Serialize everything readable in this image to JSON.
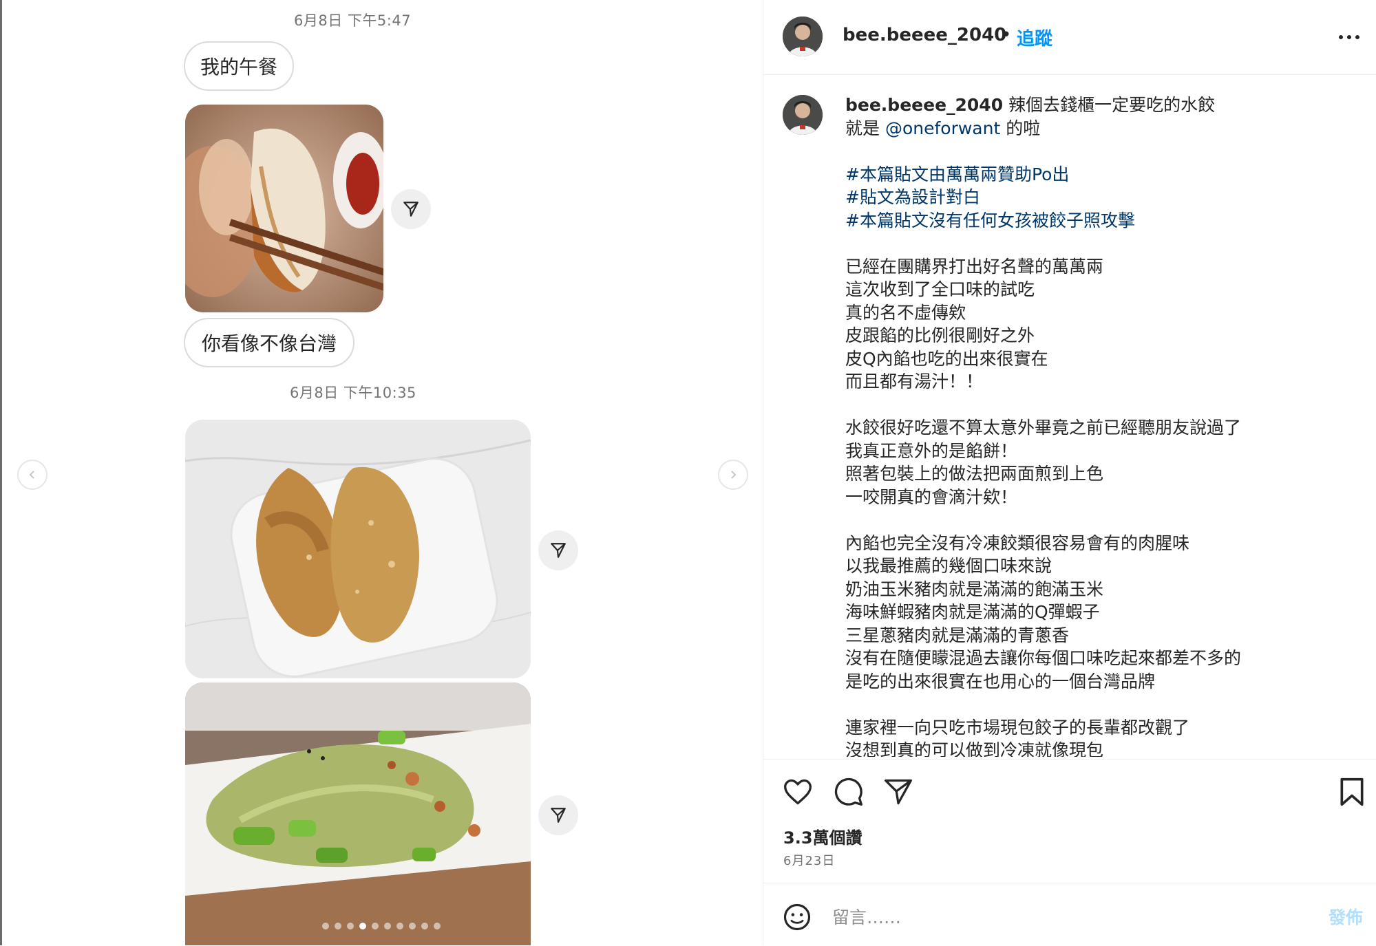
{
  "chat": {
    "timestamp_1": "6月8日 下午5:47",
    "bubble_1": "我的午餐",
    "bubble_2": "你看像不像台灣",
    "timestamp_2": "6月8日 下午10:35"
  },
  "carousel": {
    "slide_count": 10,
    "active_slide": 4
  },
  "post": {
    "username": "bee.beeee_2040",
    "follow_label": "追蹤",
    "caption_first": "辣個去錢櫃一定要吃的水餃",
    "caption_second_prefix": "就是 ",
    "mention": "@oneforwant",
    "caption_second_suffix": " 的啦",
    "hashtags": [
      "#本篇貼文由萬萬兩贊助Po出",
      "#貼文為設計對白",
      "#本篇貼文沒有任何女孩被餃子照攻擊"
    ],
    "paragraph_1": [
      "已經在團購界打出好名聲的萬萬兩",
      "這次收到了全口味的試吃",
      "真的名不虛傳欸",
      "皮跟餡的比例很剛好之外",
      "皮Q內餡也吃的出來很實在",
      "而且都有湯汁！！"
    ],
    "paragraph_2": [
      "水餃很好吃還不算太意外畢竟之前已經聽朋友說過了",
      "我真正意外的是餡餅！",
      "照著包裝上的做法把兩面煎到上色",
      "一咬開真的會滴汁欸！"
    ],
    "paragraph_3": [
      "內餡也完全沒有冷凍餃類很容易會有的肉腥味",
      "以我最推薦的幾個口味來說",
      "奶油玉米豬肉就是滿滿的飽滿玉米",
      "海味鮮蝦豬肉就是滿滿的Q彈蝦子",
      "三星蔥豬肉就是滿滿的青蔥香",
      "沒有在隨便矇混過去讓你每個口味吃起來都差不多的",
      "是吃的出來很實在也用心的一個台灣品牌"
    ],
    "paragraph_4": [
      "連家裡一向只吃市場現包餃子的長輩都改觀了",
      "沒想到真的可以做到冷凍就像現包"
    ],
    "likes": "3.3萬個讚",
    "date": "6月23日",
    "comment_placeholder": "留言……",
    "post_button": "發佈"
  },
  "colors": {
    "link": "#0095f6",
    "hashtag": "#00376b",
    "muted": "#737373",
    "border": "#dbdbdb"
  }
}
